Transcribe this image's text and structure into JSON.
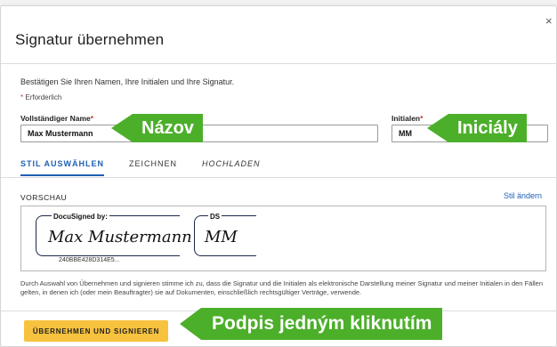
{
  "dialog": {
    "title": "Signatur übernehmen",
    "close_symbol": "×",
    "intro": "Bestätigen Sie Ihren Namen, Ihre Initialen und Ihre Signatur.",
    "required_marker": "*",
    "required_note": "Erforderlich"
  },
  "form": {
    "name_label": "Vollständiger Name",
    "name_value": "Max Mustermann",
    "initials_label": "Initialen",
    "initials_value": "MM"
  },
  "tabs": [
    {
      "label": "STIL AUSWÄHLEN",
      "active": true
    },
    {
      "label": "ZEICHNEN",
      "active": false
    },
    {
      "label": "HOCHLADEN",
      "active": false
    }
  ],
  "preview": {
    "label": "VORSCHAU",
    "change_style": "Stil ändern",
    "signature_header": "DocuSigned by:",
    "signature_text": "Max Mustermann",
    "signature_id": "240BBE428D314E5...",
    "initials_header": "DS",
    "initials_text": "MM"
  },
  "consent": "Durch Auswahl von Übernehmen und signieren stimme ich zu, dass die Signatur und die Initialen als elektronische Darstellung meiner Signatur und meiner Initialen in den Fällen gelten, in denen ich (oder mein Beauftragter) sie auf Dokumenten, einschließlich rechtsgültiger Verträge, verwende.",
  "adopt_button": "ÜBERNEHMEN UND SIGNIEREN",
  "callouts": {
    "name": "Názov",
    "initials": "Iniciály",
    "sign": "Podpis jedným kliknutím"
  },
  "colors": {
    "accent": "#1f5fb4",
    "button": "#f7c23d",
    "callout": "#4caf2a",
    "required": "#c0392b"
  }
}
